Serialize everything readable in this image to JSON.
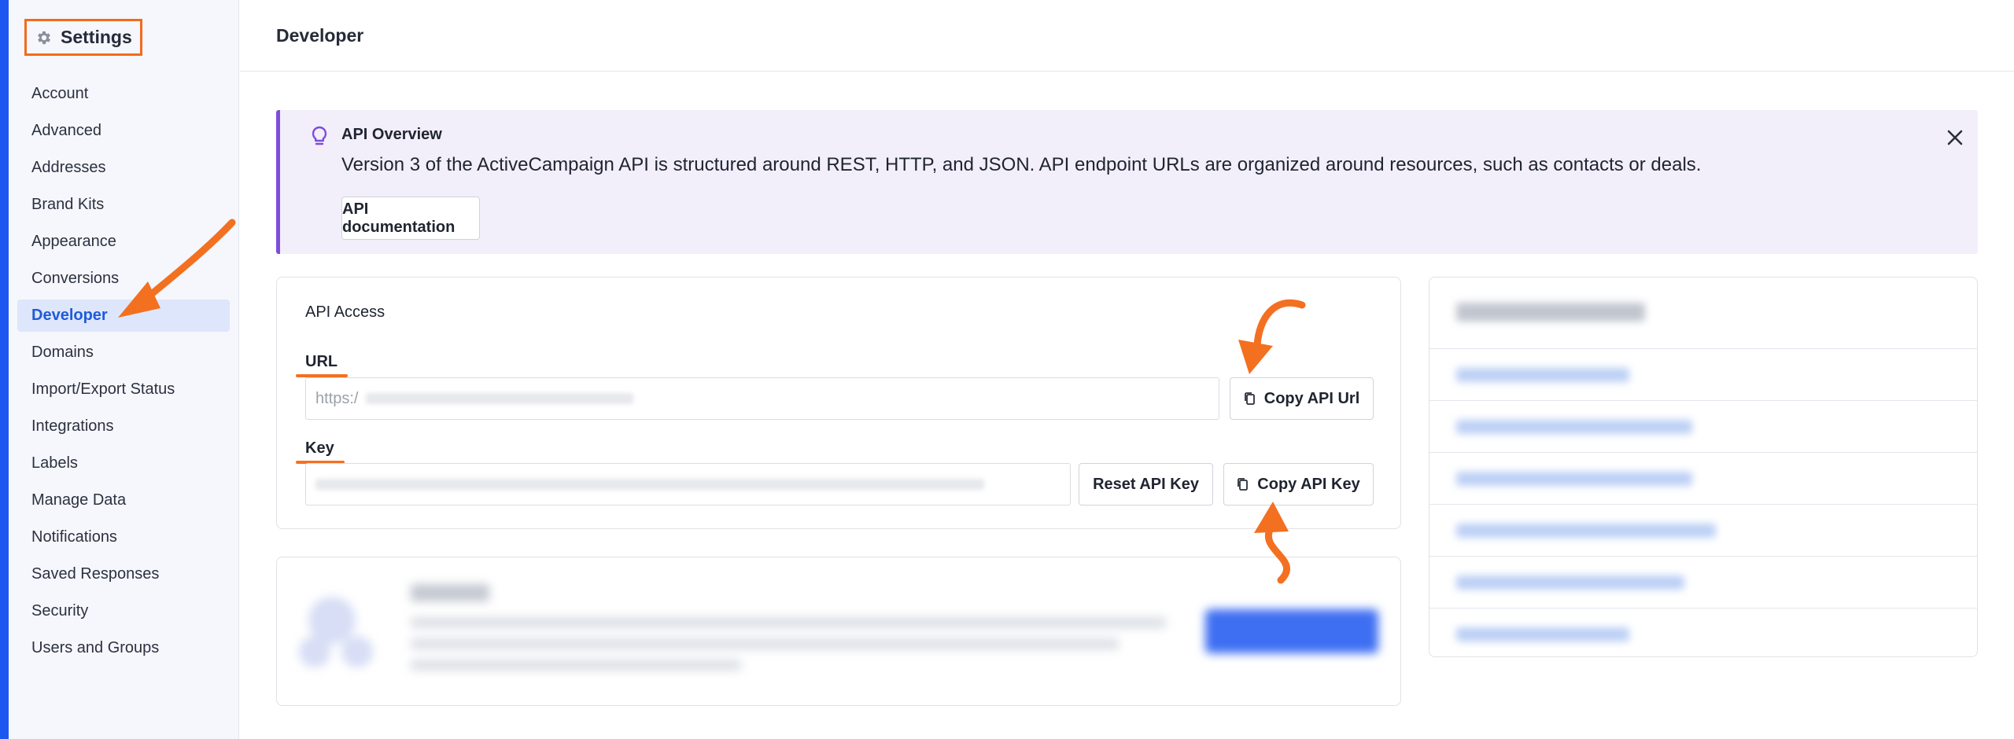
{
  "sidebar": {
    "title": "Settings",
    "items": [
      {
        "label": "Account"
      },
      {
        "label": "Advanced"
      },
      {
        "label": "Addresses"
      },
      {
        "label": "Brand Kits"
      },
      {
        "label": "Appearance"
      },
      {
        "label": "Conversions"
      },
      {
        "label": "Developer",
        "active": true
      },
      {
        "label": "Domains"
      },
      {
        "label": "Import/Export Status"
      },
      {
        "label": "Integrations"
      },
      {
        "label": "Labels"
      },
      {
        "label": "Manage Data"
      },
      {
        "label": "Notifications"
      },
      {
        "label": "Saved Responses"
      },
      {
        "label": "Security"
      },
      {
        "label": "Users and Groups"
      }
    ]
  },
  "header": {
    "title": "Developer"
  },
  "banner": {
    "title": "API Overview",
    "text": "Version 3 of the ActiveCampaign API is structured around REST, HTTP, and JSON. API endpoint URLs are organized around resources, such as contacts or deals.",
    "doc_button": "API documentation",
    "icon": "lightbulb-icon"
  },
  "api_access": {
    "title": "API Access",
    "url_label": "URL",
    "url_value": "https:/",
    "copy_url_button": "Copy API Url",
    "key_label": "Key",
    "reset_key_button": "Reset API Key",
    "copy_key_button": "Copy API Key"
  },
  "colors": {
    "accent": "#1f5bd8",
    "annotation": "#f37021",
    "banner_border": "#7f4ddb",
    "banner_bg": "#f2effb"
  }
}
